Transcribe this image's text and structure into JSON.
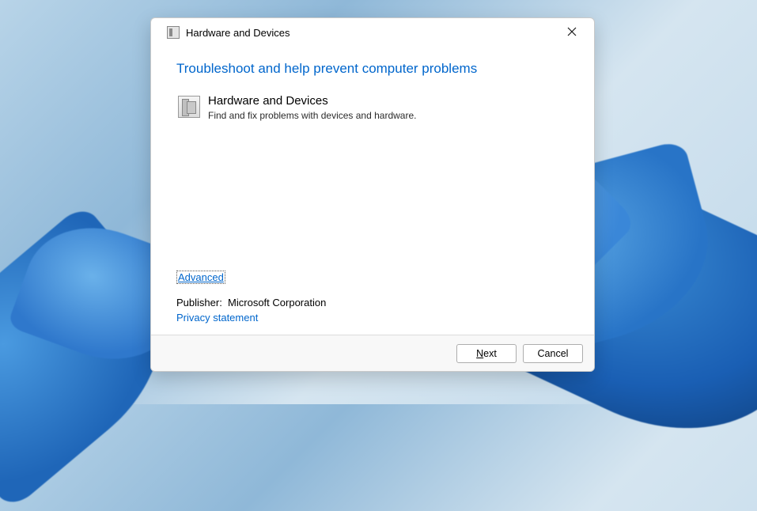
{
  "window": {
    "title": "Hardware and Devices"
  },
  "content": {
    "heading": "Troubleshoot and help prevent computer problems",
    "item": {
      "title": "Hardware and Devices",
      "description": "Find and fix problems with devices and hardware."
    },
    "advanced_label": "Advanced",
    "publisher_label": "Publisher",
    "publisher_value": "Microsoft Corporation",
    "privacy_label": "Privacy statement"
  },
  "footer": {
    "next_accel": "N",
    "next_rest": "ext",
    "cancel_label": "Cancel"
  }
}
